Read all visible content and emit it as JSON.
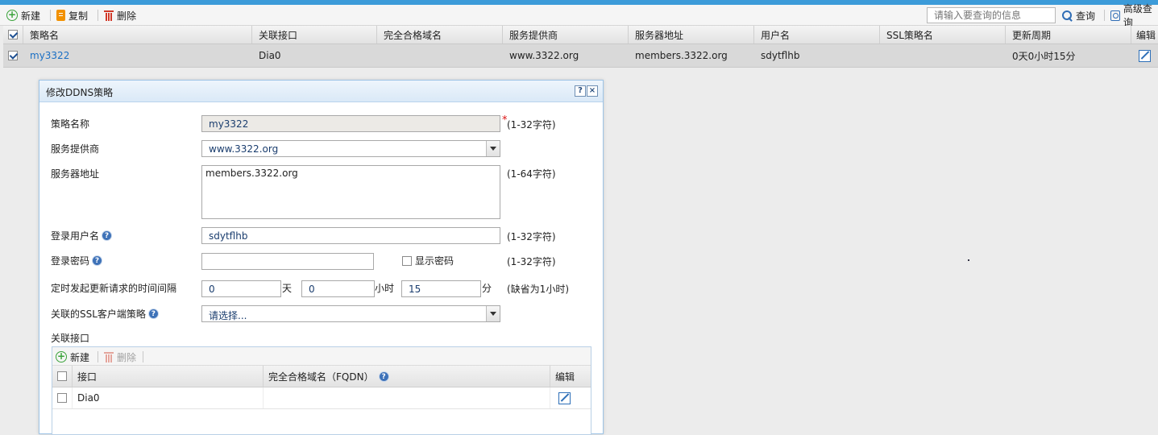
{
  "toolbar": {
    "new_label": "新建",
    "copy_label": "复制",
    "delete_label": "删除",
    "search_placeholder": "请输入要查询的信息",
    "query_label": "查询",
    "advanced_label": "高级查询"
  },
  "grid": {
    "columns": [
      "策略名",
      "关联接口",
      "完全合格域名",
      "服务提供商",
      "服务器地址",
      "用户名",
      "SSL策略名",
      "更新周期",
      "编辑"
    ],
    "rows": [
      {
        "checked": true,
        "name": "my3322",
        "interface": "Dia0",
        "fqdn": "",
        "provider": "www.3322.org",
        "server": "members.3322.org",
        "username": "sdytflhb",
        "ssl_policy": "",
        "period": "0天0小时15分"
      }
    ]
  },
  "dialog": {
    "title": "修改DDNS策略",
    "help_btn": "?",
    "close_btn": "×",
    "fields": {
      "policy_name": {
        "label": "策略名称",
        "value": "my3322",
        "required": "*",
        "hint": "(1-32字符)"
      },
      "provider": {
        "label": "服务提供商",
        "value": "www.3322.org"
      },
      "server": {
        "label": "服务器地址",
        "value": "members.3322.org",
        "hint": "(1-64字符)"
      },
      "username": {
        "label": "登录用户名",
        "value": "sdytflhb",
        "hint": "(1-32字符)"
      },
      "password": {
        "label": "登录密码",
        "value": "",
        "show_label": "显示密码",
        "show_checked": false,
        "hint": "(1-32字符)"
      },
      "interval": {
        "label": "定时发起更新请求的时间间隔",
        "days": "0",
        "days_unit": "天",
        "hours": "0",
        "hours_unit": "小时",
        "minutes": "15",
        "minutes_unit": "分",
        "hint": "(缺省为1小时)"
      },
      "ssl": {
        "label": "关联的SSL客户端策略",
        "value": "请选择..."
      },
      "interfaces_label": "关联接口"
    },
    "subtable": {
      "new_label": "新建",
      "delete_label": "删除",
      "columns": [
        "接口",
        "完全合格域名（FQDN）",
        "编辑"
      ],
      "rows": [
        {
          "interface": "Dia0",
          "fqdn": ""
        }
      ]
    }
  },
  "colors": {
    "accent": "#3c9bd9",
    "link": "#1a6fc4",
    "dialog_border": "#9ec4e6"
  }
}
